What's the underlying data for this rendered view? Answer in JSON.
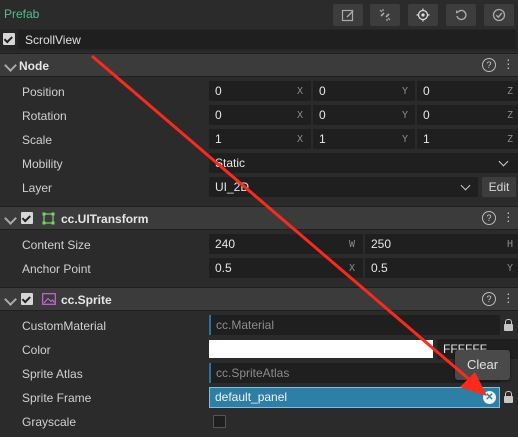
{
  "header": {
    "prefab_label": "Prefab"
  },
  "node_name": "ScrollView",
  "sections": {
    "node": {
      "title": "Node"
    },
    "transform": {
      "title": "cc.UITransform"
    },
    "sprite": {
      "title": "cc.Sprite"
    }
  },
  "node": {
    "position": {
      "label": "Position",
      "x": "0",
      "y": "0",
      "z": "0"
    },
    "rotation": {
      "label": "Rotation",
      "x": "0",
      "y": "0",
      "z": "0"
    },
    "scale": {
      "label": "Scale",
      "x": "1",
      "y": "1",
      "z": "1"
    },
    "mobility": {
      "label": "Mobility",
      "value": "Static"
    },
    "layer": {
      "label": "Layer",
      "value": "UI_2D",
      "edit": "Edit"
    },
    "axes": {
      "x": "X",
      "y": "Y",
      "z": "Z",
      "w": "W",
      "h": "H"
    }
  },
  "transform": {
    "content_size": {
      "label": "Content Size",
      "w": "240",
      "h": "250"
    },
    "anchor_point": {
      "label": "Anchor Point",
      "x": "0.5",
      "y": "0.5"
    }
  },
  "sprite": {
    "custom_material": {
      "label": "CustomMaterial",
      "value": "cc.Material"
    },
    "color": {
      "label": "Color",
      "hex": "FFFFFF"
    },
    "sprite_atlas": {
      "label": "Sprite Atlas",
      "value": "cc.SpriteAtlas"
    },
    "sprite_frame": {
      "label": "Sprite Frame",
      "value": "default_panel"
    },
    "grayscale": {
      "label": "Grayscale"
    }
  },
  "tooltip": {
    "text": "Clear"
  },
  "colors": {
    "accent": "#4fbf8f",
    "select_blue": "#2d7fa5",
    "arrow": "#ff2a1a"
  }
}
